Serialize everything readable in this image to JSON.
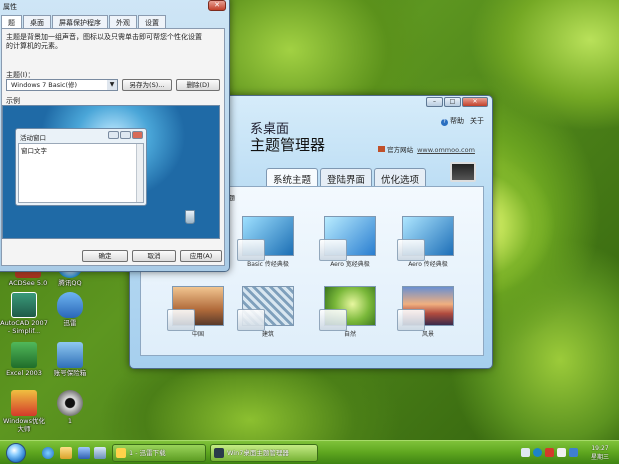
{
  "colors": {
    "taskbar": "#5ea61f",
    "window_frame": "#a9cbe6",
    "close_button": "#c2402a"
  },
  "properties_window": {
    "title": "属性",
    "close_label": "✕",
    "tabs": [
      "题",
      "桌面",
      "屏幕保护程序",
      "外观",
      "设置"
    ],
    "description": "主题是背景加一组声音，图标以及只需单击即可帮您个性化设置\n的计算机的元素。",
    "theme_label": "主题(I)：",
    "theme_value": "Windows 7 Basic(修)",
    "save_as_label": "另存为(S)...",
    "delete_label": "删除(D)",
    "sample_label": "示例",
    "sample_window_title": "活动窗口",
    "sample_window_text": "窗口文字",
    "ok_label": "确定",
    "cancel_label": "取消",
    "apply_label": "应用(A)"
  },
  "manager_window": {
    "help_label": "帮助",
    "about_label": "关于",
    "heading1": "系桌面",
    "heading2": "主题管理器",
    "site_label": "官方网站",
    "site_url": "www.ommoo.com",
    "tabs": [
      "系统主题",
      "登陆界面",
      "优化选项"
    ],
    "section_label": "主题",
    "themes": [
      {
        "name": "Basic 传经典极",
        "color": "#2d86c4"
      },
      {
        "name": "Aero 宽经典极",
        "color": "#3a8fd8"
      },
      {
        "name": "Aero 传经典极",
        "color": "#2a7ec2"
      },
      {
        "name": "中国",
        "color": "#d9a070"
      },
      {
        "name": "建筑",
        "color": "#7fa7c6"
      },
      {
        "name": "自然",
        "color": "#7ab83a"
      },
      {
        "name": "风景",
        "color": "#b04a3e"
      }
    ]
  },
  "desktop_icons": [
    {
      "label": "ACDSee 5.0",
      "color": "#c64a2b"
    },
    {
      "label": "腾讯QQ",
      "color": "#1d83c9"
    },
    {
      "label": "AutoCAD 2007\n- Simplif...",
      "color": "#c8322a"
    },
    {
      "label": "迅雷",
      "color": "#3f7fd0"
    },
    {
      "label": "Excel 2003",
      "color": "#2f8a3a"
    },
    {
      "label": "账号保险箱",
      "color": "#2f6fb8"
    },
    {
      "label": "Windows优化\n大师",
      "color": "#d33a2a"
    },
    {
      "label": "1",
      "color": "#333333"
    }
  ],
  "taskbar": {
    "tasks": [
      "1 - 迅雷下载",
      "Win7桌面主题管理器"
    ],
    "clock_time": "19:27",
    "clock_day": "星期三"
  }
}
